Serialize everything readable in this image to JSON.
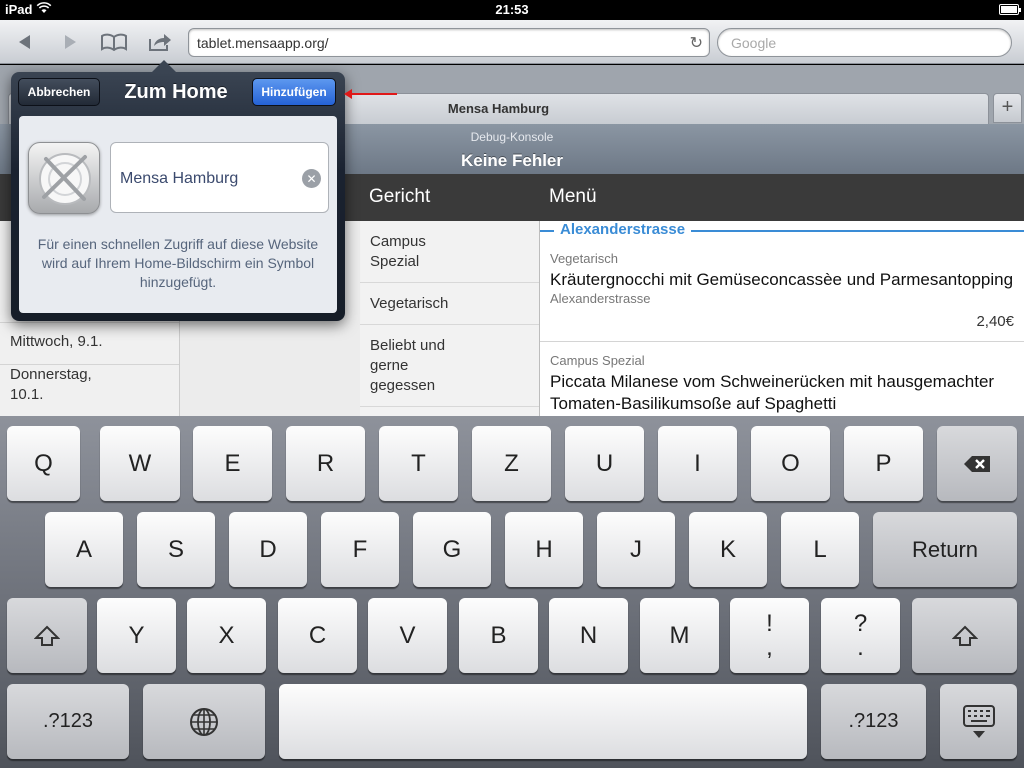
{
  "status_bar": {
    "carrier": "iPad",
    "time": "21:53"
  },
  "toolbar": {
    "url": "tablet.mensaapp.org/",
    "search_placeholder": "Google"
  },
  "tab": {
    "title": "Mensa Hamburg"
  },
  "debug": {
    "label": "Debug-Konsole",
    "value": "Keine Fehler"
  },
  "content": {
    "days": [
      "Mittwoch, 9.1.",
      "Donnerstag,\n10.1."
    ],
    "category_header": "Gericht",
    "categories": [
      "Campus\nSpezial",
      "Vegetarisch",
      "Beliebt und\ngerne\ngegessen"
    ],
    "menu_header": "Menü",
    "section": "Alexanderstrasse",
    "dishes": [
      {
        "category": "Vegetarisch",
        "name": "Kräutergnocchi mit Gemüseconcassèe und Parmesantopping",
        "location": "Alexanderstrasse",
        "price": "2,40€"
      },
      {
        "category": "Campus Spezial",
        "name": "Piccata Milanese vom Schweinerücken mit hausgemachter Tomaten-Basilikumsoße auf Spaghetti"
      }
    ]
  },
  "popover": {
    "cancel_label": "Abbrechen",
    "title": "Zum Home",
    "add_label": "Hinzufügen",
    "name_value": "Mensa Hamburg",
    "hint": "Für einen schnellen Zugriff auf diese Website wird auf Ihrem Home-Bildschirm ein Symbol hinzugefügt."
  },
  "keyboard": {
    "row1": [
      "Q",
      "W",
      "E",
      "R",
      "T",
      "Z",
      "U",
      "I",
      "O",
      "P"
    ],
    "row2": [
      "A",
      "S",
      "D",
      "F",
      "G",
      "H",
      "J",
      "K",
      "L"
    ],
    "return_label": "Return",
    "row3": [
      "Y",
      "X",
      "C",
      "V",
      "B",
      "N",
      "M"
    ],
    "punct1_top": "!",
    "punct1_bottom": ",",
    "punct2_top": "?",
    "punct2_bottom": ".",
    "numbers_label": ".?123"
  },
  "colors": {
    "accent_blue": "#3a8cd6",
    "add_button": "#2f6fe0",
    "annotation_red": "#e01818"
  }
}
